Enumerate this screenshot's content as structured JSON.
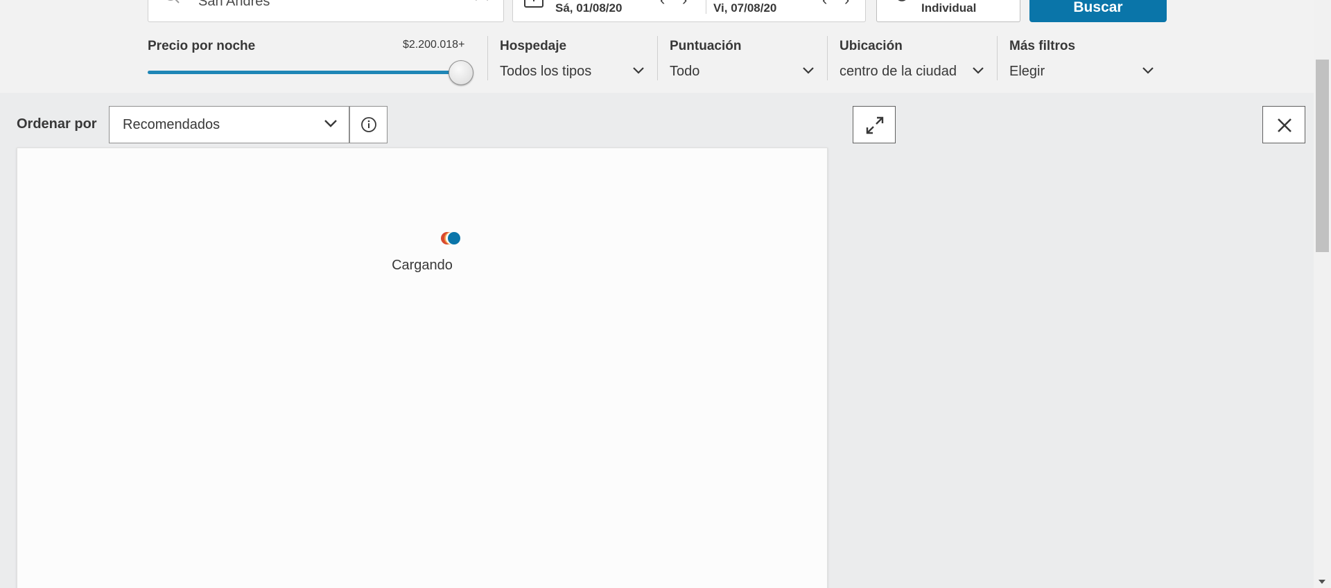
{
  "search": {
    "destination": "San Andrés",
    "check_in": "Sá, 01/08/20",
    "check_out": "Vi, 07/08/20",
    "guests": "Individual",
    "search_button": "Buscar"
  },
  "filters": {
    "price": {
      "label": "Precio por noche",
      "max_value": "$2.200.018+",
      "slider_fraction": 1.0
    },
    "lodging": {
      "label": "Hospedaje",
      "value": "Todos los tipos"
    },
    "rating": {
      "label": "Puntuación",
      "value": "Todo"
    },
    "location": {
      "label": "Ubicación",
      "value": "centro de la ciudad"
    },
    "more": {
      "label": "Más filtros",
      "value": "Elegir"
    }
  },
  "sort": {
    "label": "Ordenar por",
    "value": "Recomendados"
  },
  "results": {
    "loading_text": "Cargando"
  },
  "colors": {
    "primary": "#0a75a9",
    "loader_red": "#d9492f",
    "loader_orange": "#f2a24a",
    "loader_blue": "#0a75a9",
    "background": "#ebeced"
  }
}
